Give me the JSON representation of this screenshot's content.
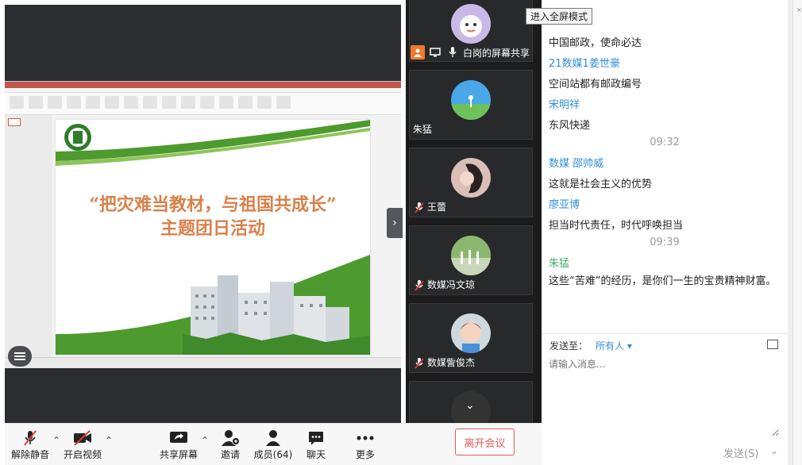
{
  "tooltip": {
    "fullscreen": "进入全屏模式"
  },
  "slide": {
    "title_line1": "“把灾难当教材，与祖国共成长”",
    "title_line2": "主题团日活动"
  },
  "participants": {
    "share_label": "白岗的屏幕共享",
    "tiles": [
      {
        "name": "朱猛"
      },
      {
        "name": "王蕾"
      },
      {
        "name": "数媒冯文琼"
      },
      {
        "name": "数媒訾俊杰"
      }
    ]
  },
  "chat": {
    "messages": [
      {
        "text": "中国邮政，使命必达"
      },
      {
        "sender": "21数媒1姜世豪"
      },
      {
        "text": "空间站都有邮政编号"
      },
      {
        "sender": "宋明祥"
      },
      {
        "text": "东风快递"
      },
      {
        "time": "09:32"
      },
      {
        "sender": "数媒 邵帅威"
      },
      {
        "text": "这就是社会主义的优势"
      },
      {
        "sender": "廖亚博"
      },
      {
        "text": "担当时代责任，时代呼唤担当"
      },
      {
        "time": "09:39"
      },
      {
        "sender": "朱猛"
      },
      {
        "text": "这些“苦难”的经历，是你们一生的宝贵精神财富。"
      }
    ],
    "send_to_label": "发送至：",
    "send_to_target": "所有人 ▾",
    "input_placeholder": "请输入消息...",
    "send_button": "发送(S)"
  },
  "toolbar": {
    "unmute": "解除静音",
    "start_video": "开启视频",
    "share_screen": "共享屏幕",
    "invite": "邀请",
    "members": "成员(64)",
    "chat": "聊天",
    "more": "更多",
    "leave": "离开会议"
  },
  "colors": {
    "leave": "#e15b5b",
    "sender_blue": "#2f8fd6",
    "sender_green": "#3fae69",
    "slide_title": "#d9804a",
    "mic_off_red": "#e03a3a"
  }
}
